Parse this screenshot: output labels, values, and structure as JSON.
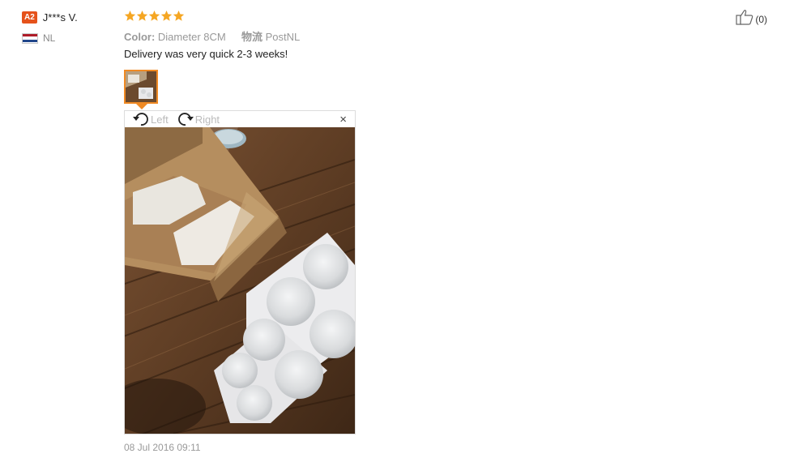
{
  "user": {
    "level_badge": "A2",
    "name": "J***s V.",
    "country": "NL"
  },
  "review": {
    "rating": 5,
    "color_label": "Color:",
    "color_value": "Diameter 8CM",
    "shipping_label": "物流",
    "shipping_value": "PostNL",
    "text": "Delivery was very quick 2-3 weeks!",
    "date": "08 Jul 2016 09:11"
  },
  "viewer": {
    "rotate_left_label": "Left",
    "rotate_right_label": "Right",
    "close_symbol": "×"
  },
  "helpful": {
    "count_text": "(0)"
  },
  "colors": {
    "badge": "#e5521b",
    "star": "#f5a623",
    "thumb_border": "#f08a24"
  },
  "icons": [
    "star-icon",
    "rotate-left-icon",
    "rotate-right-icon",
    "close-icon",
    "thumbs-up-icon",
    "flag-icon"
  ]
}
